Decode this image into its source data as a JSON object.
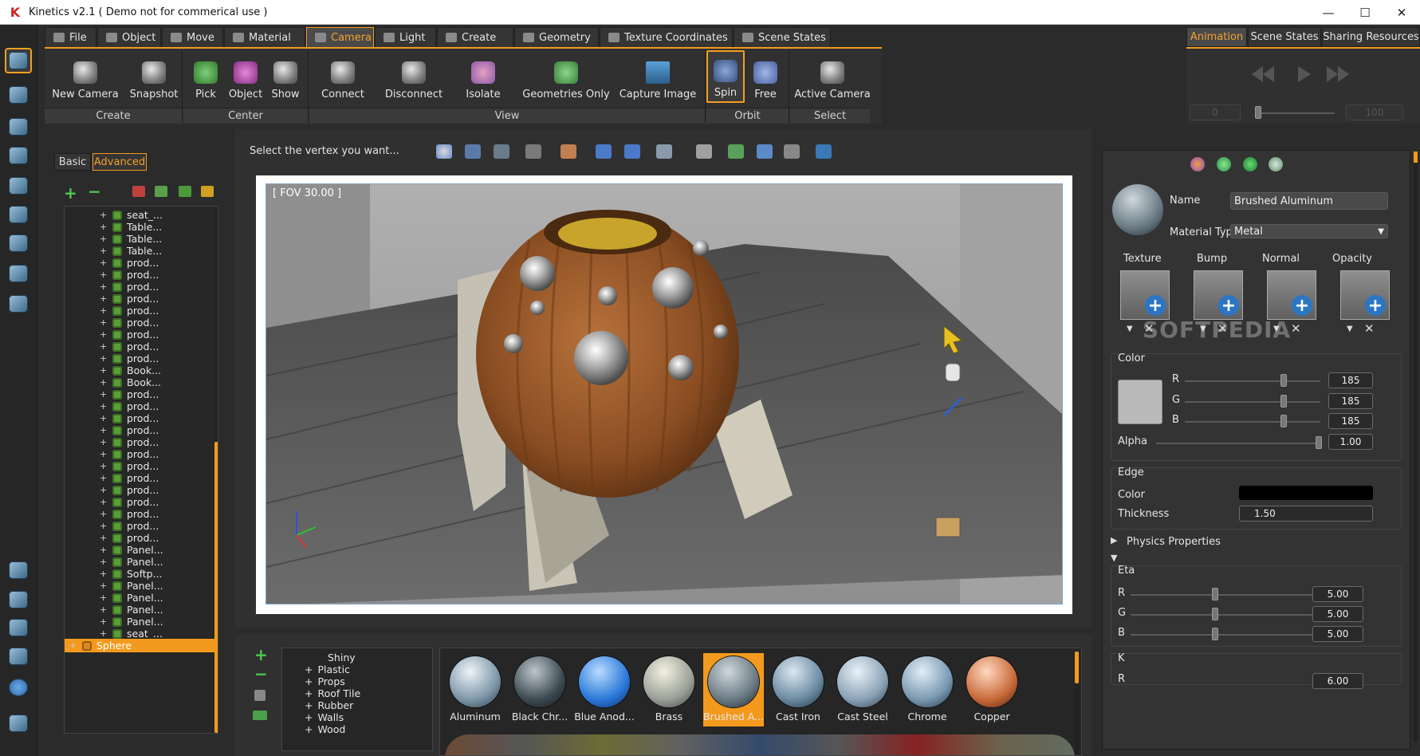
{
  "window": {
    "title": "Kinetics v2.1 ( Demo not for commerical use )",
    "logo": "K"
  },
  "menu_tabs": [
    "File",
    "Object",
    "Move",
    "Material",
    "Camera",
    "Light",
    "Create",
    "Geometry",
    "Texture Coordinates",
    "Scene States"
  ],
  "active_menu_tab": "Camera",
  "ribbon": {
    "buttons": [
      "New Camera",
      "Snapshot",
      "Pick",
      "Object",
      "Show",
      "Connect",
      "Disconnect",
      "Isolate",
      "Geometries Only",
      "Capture Image",
      "Spin",
      "Free",
      "Active Camera"
    ],
    "groups": [
      "Create",
      "Center",
      "View",
      "Orbit",
      "Select"
    ]
  },
  "right_tabs": [
    "Animation",
    "Scene States",
    "Sharing Resources"
  ],
  "animation": {
    "start": "0",
    "end": "100"
  },
  "tree_panel": {
    "tabs": [
      "Basic",
      "Advanced"
    ],
    "items": [
      "seat_...",
      "Table...",
      "Table...",
      "Table...",
      "prod...",
      "prod...",
      "prod...",
      "prod...",
      "prod...",
      "prod...",
      "prod...",
      "prod...",
      "prod...",
      "Book...",
      "Book...",
      "prod...",
      "prod...",
      "prod...",
      "prod...",
      "prod...",
      "prod...",
      "prod...",
      "prod...",
      "prod...",
      "prod...",
      "prod...",
      "prod...",
      "prod...",
      "Panel...",
      "Panel...",
      "Softp...",
      "Panel...",
      "Panel...",
      "Panel...",
      "Panel...",
      "seat_..."
    ],
    "selected": "Sphere"
  },
  "viewport": {
    "status": "Select the vertex you want...",
    "fov": "[ FOV 30.00 ]"
  },
  "materials": {
    "categories": [
      "Shiny",
      "Plastic",
      "Props",
      "Roof Tile",
      "Rubber",
      "Walls",
      "Wood"
    ],
    "swatches": [
      "Aluminum",
      "Black Chr...",
      "Blue Anod...",
      "Brass",
      "Brushed A...",
      "Cast Iron",
      "Cast Steel",
      "Chrome",
      "Copper"
    ],
    "selected": "Brushed A..."
  },
  "properties": {
    "name_label": "Name",
    "name_value": "Brushed Aluminum",
    "type_label": "Material Type",
    "type_value": "Metal",
    "maps": [
      "Texture",
      "Bump",
      "Normal",
      "Opacity"
    ],
    "color_section": "Color",
    "color": {
      "r": "185",
      "g": "185",
      "b": "185",
      "alpha": "1.00",
      "swatch": "#b9b9b9"
    },
    "labels": {
      "r": "R",
      "g": "G",
      "b": "B",
      "alpha": "Alpha"
    },
    "edge_section": "Edge",
    "edge": {
      "color_label": "Color",
      "color_value": "#000000",
      "thickness_label": "Thickness",
      "thickness": "1.50"
    },
    "physics": "Physics Properties",
    "eta_section": "Eta",
    "eta": {
      "r": "5.00",
      "g": "5.00",
      "b": "5.00"
    },
    "k_section": "K",
    "k_r": "6.00"
  },
  "watermark": "SOFTPEDIA",
  "colors": {
    "accent": "#f39a1e",
    "panel": "#2b2b2b"
  }
}
